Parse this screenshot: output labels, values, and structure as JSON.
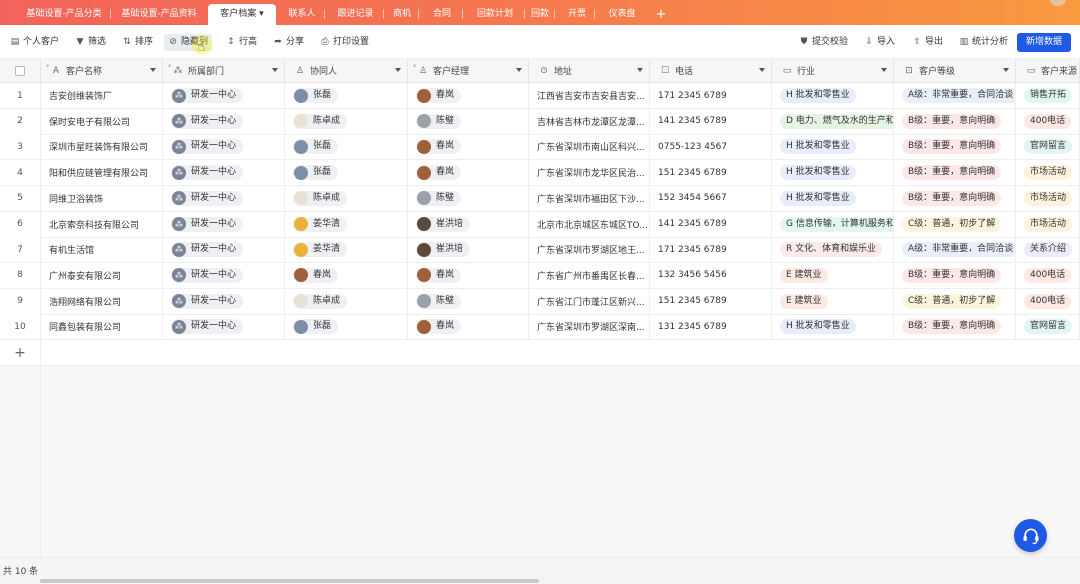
{
  "tabs": [
    {
      "label": "基础设置-产品分类",
      "active": false
    },
    {
      "label": "基础设置-产品资料",
      "active": false
    },
    {
      "label": "客户档案",
      "active": true
    },
    {
      "label": "联系人",
      "active": false
    },
    {
      "label": "跟进记录",
      "active": false
    },
    {
      "label": "商机",
      "active": false
    },
    {
      "label": "合同",
      "active": false
    },
    {
      "label": "回款计划",
      "active": false
    },
    {
      "label": "回款",
      "active": false
    },
    {
      "label": "开票",
      "active": false
    },
    {
      "label": "仪表盘",
      "active": false
    }
  ],
  "add_tab_symbol": "+",
  "toolbar": {
    "personal_customer": "个人客户",
    "filter": "筛选",
    "sort": "排序",
    "hide": "隐藏列",
    "row_height": "行高",
    "share": "分享",
    "print": "打印设置",
    "submit_check": "提交校验",
    "import": "导入",
    "export": "导出",
    "stats": "统计分析",
    "new_data": "新增数据"
  },
  "columns": [
    "客户名称",
    "所属部门",
    "协同人",
    "客户经理",
    "地址",
    "电话",
    "行业",
    "客户等级",
    "客户来源"
  ],
  "rows": [
    {
      "no": "1",
      "name": "吉安创维装饰厂",
      "dept": "研发一中心",
      "collab": "张磊",
      "manager": "春岚",
      "addr": "江西省吉安市吉安县吉安...",
      "phone": "171 2345 6789",
      "industry": "H 批发和零售业",
      "ind_cls": "ind",
      "level": "A级：非常重要，合同洽谈",
      "lv_cls": "lv-a",
      "source": "销售开拓",
      "src_cls": "src-a"
    },
    {
      "no": "2",
      "name": "保时安电子有限公司",
      "dept": "研发一中心",
      "collab": "陈卓成",
      "manager": "陈璧",
      "addr": "吉林省吉林市龙潭区龙潭...",
      "phone": "141 2345 6789",
      "industry": "D 电力、燃气及水的生产和供应",
      "ind_cls": "ind-d",
      "level": "B级：重要，意向明确",
      "lv_cls": "lv-b",
      "source": "400电话",
      "src_cls": "src-b"
    },
    {
      "no": "3",
      "name": "深圳市星旺装饰有限公司",
      "dept": "研发一中心",
      "collab": "张磊",
      "manager": "春岚",
      "addr": "广东省深圳市南山区科兴...",
      "phone": "0755-123 4567",
      "industry": "H 批发和零售业",
      "ind_cls": "ind",
      "level": "B级：重要，意向明确",
      "lv_cls": "lv-b",
      "source": "官网留言",
      "src_cls": "src-a"
    },
    {
      "no": "4",
      "name": "阳和供应链管理有限公司",
      "dept": "研发一中心",
      "collab": "张磊",
      "manager": "春岚",
      "addr": "广东省深圳市龙华区民治...",
      "phone": "151 2345 6789",
      "industry": "H 批发和零售业",
      "ind_cls": "ind",
      "level": "B级：重要，意向明确",
      "lv_cls": "lv-b",
      "source": "市场活动",
      "src_cls": "src-c"
    },
    {
      "no": "5",
      "name": "同维卫浴装饰",
      "dept": "研发一中心",
      "collab": "陈卓成",
      "manager": "陈璧",
      "addr": "广东省深圳市福田区下沙...",
      "phone": "152 3454 5667",
      "industry": "H 批发和零售业",
      "ind_cls": "ind",
      "level": "B级：重要，意向明确",
      "lv_cls": "lv-b",
      "source": "市场活动",
      "src_cls": "src-c"
    },
    {
      "no": "6",
      "name": "北京索奈科技有限公司",
      "dept": "研发一中心",
      "collab": "姜华清",
      "manager": "崔洪培",
      "addr": "北京市北京城区东城区TO...",
      "phone": "141 2345 6789",
      "industry": "G 信息传输，计算机服务和软件业",
      "ind_cls": "ind-g",
      "level": "C级：普通，初步了解",
      "lv_cls": "lv-c",
      "source": "市场活动",
      "src_cls": "src-c"
    },
    {
      "no": "7",
      "name": "有机生活馆",
      "dept": "研发一中心",
      "collab": "姜华清",
      "manager": "崔洪培",
      "addr": "广东省深圳市罗湖区地王...",
      "phone": "171 2345 6789",
      "industry": "R 文化、体育和娱乐业",
      "ind_cls": "ind-r",
      "level": "A级：非常重要，合同洽谈",
      "lv_cls": "lv-a",
      "source": "关系介绍",
      "src_cls": "src-d"
    },
    {
      "no": "8",
      "name": "广州泰安有限公司",
      "dept": "研发一中心",
      "collab": "春岚",
      "manager": "春岚",
      "addr": "广东省广州市番禺区长春...",
      "phone": "132 3456 5456",
      "industry": "E 建筑业",
      "ind_cls": "ind-e",
      "level": "B级：重要，意向明确",
      "lv_cls": "lv-b",
      "source": "400电话",
      "src_cls": "src-b"
    },
    {
      "no": "9",
      "name": "浩翔网络有限公司",
      "dept": "研发一中心",
      "collab": "陈卓成",
      "manager": "陈璧",
      "addr": "广东省江门市蓬江区新兴...",
      "phone": "151 2345 6789",
      "industry": "E 建筑业",
      "ind_cls": "ind-e",
      "level": "C级：普通，初步了解",
      "lv_cls": "lv-c",
      "source": "400电话",
      "src_cls": "src-b"
    },
    {
      "no": "10",
      "name": "同鑫包装有限公司",
      "dept": "研发一中心",
      "collab": "张磊",
      "manager": "春岚",
      "addr": "广东省深圳市罗湖区深南...",
      "phone": "131 2345 6789",
      "industry": "H 批发和零售业",
      "ind_cls": "ind",
      "level": "B级：重要，意向明确",
      "lv_cls": "lv-b",
      "source": "官网留言",
      "src_cls": "src-a"
    }
  ],
  "add_row_symbol": "+",
  "footer_count": "共 10 条"
}
